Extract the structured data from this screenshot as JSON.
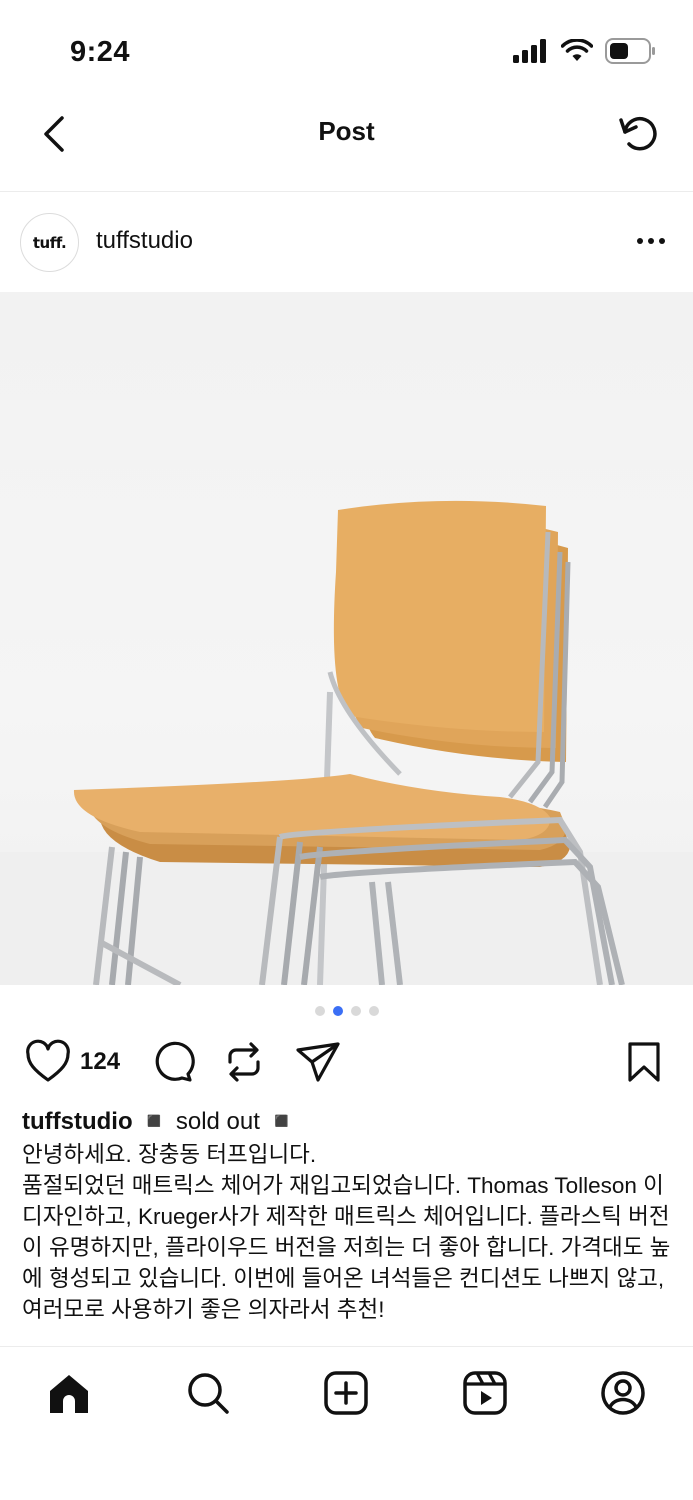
{
  "status_bar": {
    "time": "9:24",
    "icons": [
      "cellular-signal-icon",
      "wifi-icon",
      "battery-icon"
    ]
  },
  "header": {
    "title": "Post",
    "back_icon": "chevron-left-icon",
    "refresh_icon": "refresh-icon"
  },
  "post": {
    "avatar_text": "tuff.",
    "username": "tuffstudio",
    "more_icon": "more-horizontal-icon",
    "image_description_icon": "photo",
    "carousel": {
      "count": 4,
      "active_index": 1
    },
    "likes": "124",
    "caption": {
      "username": "tuffstudio",
      "headline": "◾️ sold out ◾️",
      "line1": "안녕하세요. 장충동 터프입니다.",
      "body": "품절되었던 매트릭스 체어가 재입고되었습니다. Thomas Tolleson 이 디자인하고, Krueger사가 제작한 매트릭스 체어입니다. 플라스틱 버전이 유명하지만, 플라이우드 버전을 저희는 더 좋아 합니다. 가격대도 높에 형성되고 있습니다. 이번에 들어온 녀석들은 컨디션도 나쁘지 않고, 여러모로 사용하기 좋은 의자라서 추천!"
    }
  },
  "tabbar": {
    "items": [
      "home-icon",
      "search-icon",
      "create-icon",
      "reels-icon",
      "profile-icon"
    ]
  },
  "colors": {
    "accent": "#3b6ff5",
    "text": "#111111",
    "divider": "#ececec",
    "wood": "#e3a85c",
    "chrome": "#b9bcc0"
  }
}
